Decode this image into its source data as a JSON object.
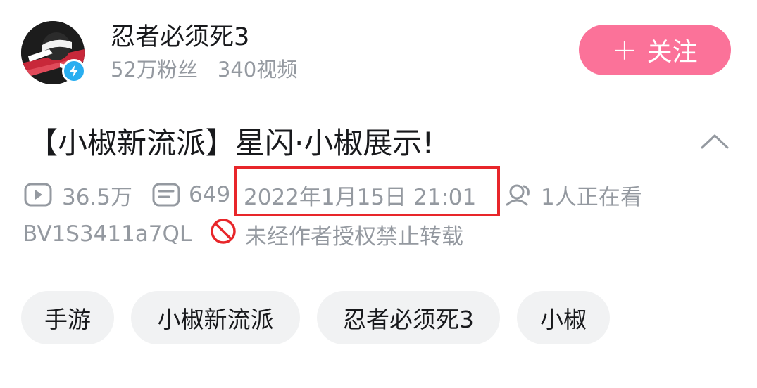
{
  "uploader": {
    "name": "忍者必须死3",
    "followers": "52万粉丝",
    "videos": "340视频",
    "follow_label": "关注"
  },
  "video": {
    "title": "【小椒新流派】星闪·小椒展示!",
    "views": "36.5万",
    "danmaku": "649",
    "publish_time": "2022年1月15日 21:01",
    "watching": "1人正在看",
    "bvid": "BV1S3411a7QL",
    "copyright": "未经作者授权禁止转载"
  },
  "tags": [
    "手游",
    "小椒新流派",
    "忍者必须死3",
    "小椒"
  ],
  "colors": {
    "follow_button": "#fb7299",
    "highlight_box": "#e8262a",
    "verified_badge": "#29aef0",
    "secondary_text": "#9499a0",
    "tag_background": "#f1f2f3"
  }
}
